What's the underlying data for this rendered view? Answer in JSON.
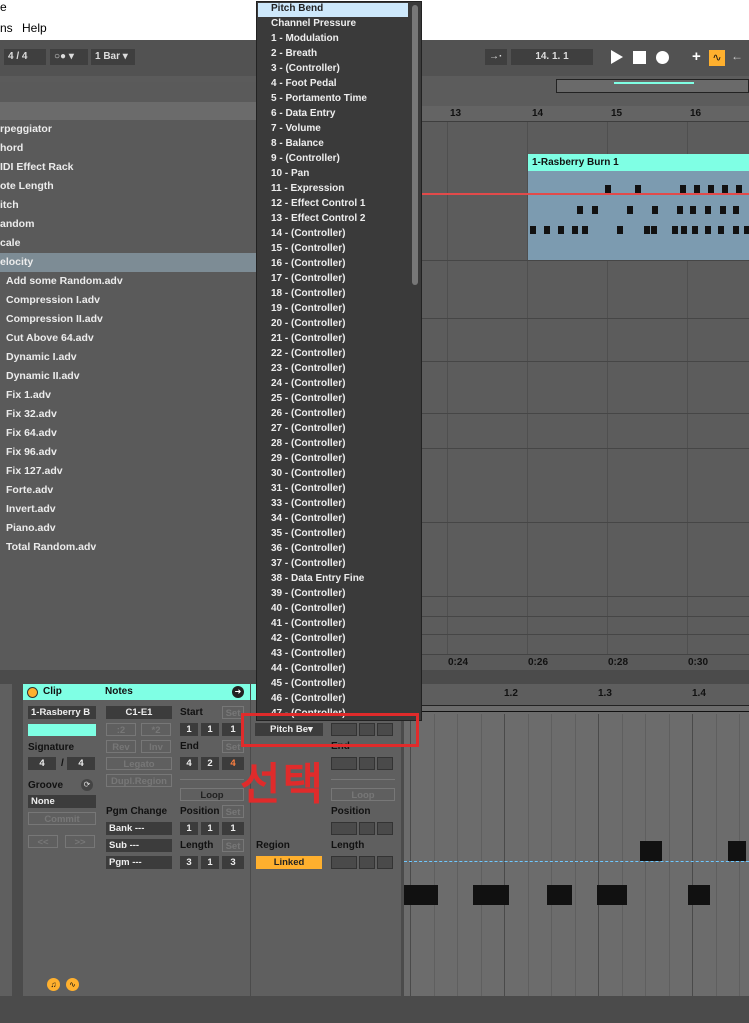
{
  "menubar": {
    "item_left": "e",
    "item_ns": "ns",
    "help": "Help"
  },
  "toolbar": {
    "signature": "4 / 4",
    "metronome": "○●",
    "quantize": "1 Bar",
    "position": "14.  1.  1"
  },
  "colors": {
    "accent": "#7fffe4",
    "highlight": "#cde8fb",
    "annotation": "#e02b2b",
    "record": "#ffffff",
    "toggle": "#ffb02e"
  },
  "browser": {
    "items": [
      "rpeggiator",
      "hord",
      "IDI Effect Rack",
      "ote Length",
      "itch",
      "andom",
      "cale",
      "elocity",
      "Add some Random.adv",
      "Compression I.adv",
      "Compression II.adv",
      "Cut Above 64.adv",
      "Dynamic I.adv",
      "Dynamic II.adv",
      "Fix 1.adv",
      "Fix 32.adv",
      "Fix 64.adv",
      "Fix 96.adv",
      "Fix 127.adv",
      "Forte.adv",
      "Invert.adv",
      "Piano.adv",
      "Total Random.adv"
    ]
  },
  "arrangement": {
    "bars": [
      "13",
      "14",
      "15",
      "16"
    ],
    "clip_name": "1-Rasberry Burn 1",
    "times": [
      "0:24",
      "0:26",
      "0:28",
      "0:30"
    ]
  },
  "dropdown": {
    "items": [
      "Pitch Bend",
      "Channel Pressure",
      "1 - Modulation",
      "2 - Breath",
      "3 - (Controller)",
      "4 - Foot Pedal",
      "5 - Portamento Time",
      "6 - Data Entry",
      "7 - Volume",
      "8 - Balance",
      "9 - (Controller)",
      "10 - Pan",
      "11 - Expression",
      "12 - Effect Control 1",
      "13 - Effect Control 2",
      "14 - (Controller)",
      "15 - (Controller)",
      "16 - (Controller)",
      "17 - (Controller)",
      "18 - (Controller)",
      "19 - (Controller)",
      "20 - (Controller)",
      "21 - (Controller)",
      "22 - (Controller)",
      "23 - (Controller)",
      "24 - (Controller)",
      "25 - (Controller)",
      "26 - (Controller)",
      "27 - (Controller)",
      "28 - (Controller)",
      "29 - (Controller)",
      "30 - (Controller)",
      "31 - (Controller)",
      "33 - (Controller)",
      "34 - (Controller)",
      "35 - (Controller)",
      "36 - (Controller)",
      "37 - (Controller)",
      "38 - Data Entry Fine",
      "39 - (Controller)",
      "40 - (Controller)",
      "41 - (Controller)",
      "42 - (Controller)",
      "43 - (Controller)",
      "44 - (Controller)",
      "45 - (Controller)",
      "46 - (Controller)",
      "47 - (Controller)"
    ]
  },
  "annotation": {
    "text": "선택"
  },
  "clip_panel": {
    "header": "Clip",
    "name": "1-Rasberry B",
    "signature_label": "Signature",
    "sig_num": "4",
    "sig_den": "4",
    "groove_label": "Groove",
    "groove_value": "None",
    "commit": "Commit",
    "nudge_left": "<<",
    "nudge_right": ">>"
  },
  "notes_panel": {
    "header": "Notes",
    "range": "C1-E1",
    "div2": ":2",
    "mul2": "*2",
    "rev": "Rev",
    "inv": "Inv",
    "legato": "Legato",
    "dupl": "Dupl.Region",
    "pgm_change": "Pgm Change",
    "bank": "Bank ---",
    "sub": "Sub ---",
    "pgm": "Pgm ---",
    "start": "Start",
    "end": "End",
    "set": "Set",
    "start_vals": [
      "1",
      "1",
      "1"
    ],
    "end_vals": [
      "4",
      "2",
      "4"
    ],
    "loop": "Loop",
    "position": "Position",
    "length": "Length",
    "pos_vals": [
      "1",
      "1",
      "1"
    ],
    "len_vals": [
      "3",
      "1",
      "3"
    ]
  },
  "envelope_panel": {
    "control_value": "Pitch Be",
    "end": "End",
    "loop": "Loop",
    "position": "Position",
    "length": "Length",
    "region": "Region",
    "linked": "Linked"
  },
  "pianoroll": {
    "bars": [
      "1.2",
      "1.3",
      "1.4"
    ]
  }
}
